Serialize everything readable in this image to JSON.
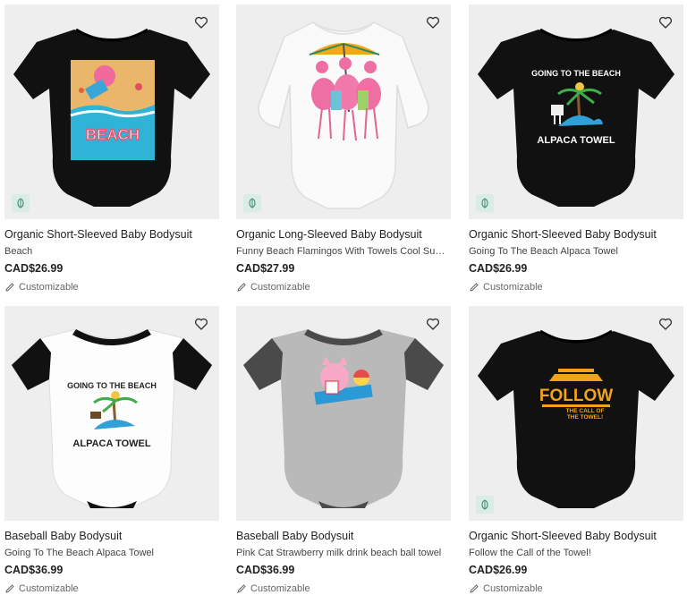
{
  "products": [
    {
      "title": "Organic Short-Sleeved Baby Bodysuit",
      "subtitle": "Beach",
      "price": "CAD$26.99",
      "customizable": "Customizable",
      "eco": true
    },
    {
      "title": "Organic Long-Sleeved Baby Bodysuit",
      "subtitle": "Funny Beach Flamingos With Towels Cool Summer",
      "price": "CAD$27.99",
      "customizable": "Customizable",
      "eco": true
    },
    {
      "title": "Organic Short-Sleeved Baby Bodysuit",
      "subtitle": "Going To The Beach Alpaca Towel",
      "price": "CAD$26.99",
      "customizable": "Customizable",
      "eco": true
    },
    {
      "title": "Baseball Baby Bodysuit",
      "subtitle": "Going To The Beach Alpaca Towel",
      "price": "CAD$36.99",
      "customizable": "Customizable",
      "eco": false
    },
    {
      "title": "Baseball Baby Bodysuit",
      "subtitle": "Pink Cat Strawberry milk drink beach ball towel",
      "price": "CAD$36.99",
      "customizable": "Customizable",
      "eco": false
    },
    {
      "title": "Organic Short-Sleeved Baby Bodysuit",
      "subtitle": "Follow the Call of the Towel!",
      "price": "CAD$26.99",
      "customizable": "Customizable",
      "eco": true
    }
  ],
  "print_text": {
    "beach": "BEACH",
    "going": "GOING TO THE BEACH",
    "alpaca": "ALPACA TOWEL",
    "follow": "FOLLOW",
    "call1": "THE CALL OF",
    "call2": "THE TOWEL!"
  },
  "colors": {
    "eco_bg": "#d9ece6",
    "eco_leaf": "#4a8f7a",
    "card_bg": "#eeeeee",
    "body_black": "#111111",
    "heather_grey": "#b9b9b9",
    "print_orange": "#f2a21b"
  }
}
